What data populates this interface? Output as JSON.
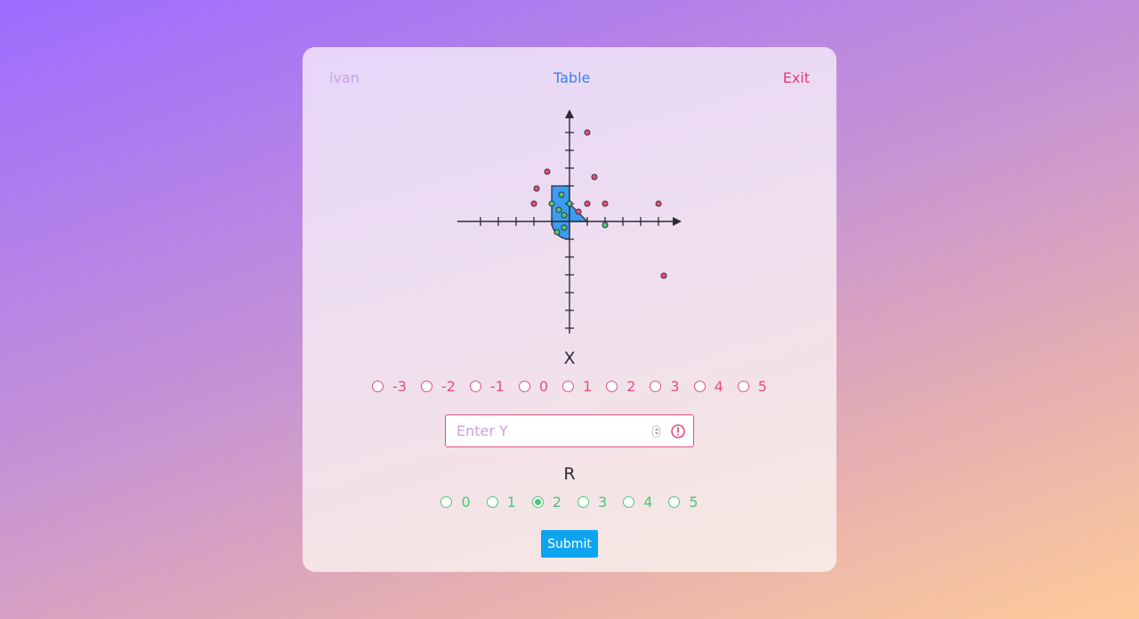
{
  "nav": {
    "user": "ivan",
    "table": "Table",
    "exit": "Exit"
  },
  "graph": {
    "radius": 2,
    "axis_color": "#2e2a35",
    "area_color": "#3b9df0",
    "hit_color": "#4cc877",
    "miss_color": "#e2507e",
    "points": [
      {
        "x": 1,
        "y": 5,
        "hit": false
      },
      {
        "x": -1.25,
        "y": 2.8,
        "hit": false
      },
      {
        "x": 1.4,
        "y": 2.5,
        "hit": false
      },
      {
        "x": -1.85,
        "y": 1.85,
        "hit": false
      },
      {
        "x": -2,
        "y": 1,
        "hit": false
      },
      {
        "x": -1,
        "y": 1,
        "hit": true
      },
      {
        "x": -0.45,
        "y": 1.5,
        "hit": true
      },
      {
        "x": 0,
        "y": 1,
        "hit": true
      },
      {
        "x": -0.6,
        "y": 0.65,
        "hit": true
      },
      {
        "x": -0.3,
        "y": 0.35,
        "hit": true
      },
      {
        "x": 1,
        "y": 1,
        "hit": false
      },
      {
        "x": 2,
        "y": 1,
        "hit": false
      },
      {
        "x": 5,
        "y": 1,
        "hit": false
      },
      {
        "x": 0.5,
        "y": 0.55,
        "hit": false
      },
      {
        "x": -0.3,
        "y": -0.35,
        "hit": true
      },
      {
        "x": -0.7,
        "y": -0.6,
        "hit": true
      },
      {
        "x": 2,
        "y": -0.2,
        "hit": true
      },
      {
        "x": 5.3,
        "y": -3.05,
        "hit": false
      }
    ]
  },
  "x_section": {
    "label": "X",
    "options": [
      "-3",
      "-2",
      "-1",
      "0",
      "1",
      "2",
      "3",
      "4",
      "5"
    ]
  },
  "y_field": {
    "placeholder": "Enter Y",
    "value": ""
  },
  "r_section": {
    "label": "R",
    "options": [
      "0",
      "1",
      "2",
      "3",
      "4",
      "5"
    ],
    "selected": "2"
  },
  "submit_label": "Submit"
}
